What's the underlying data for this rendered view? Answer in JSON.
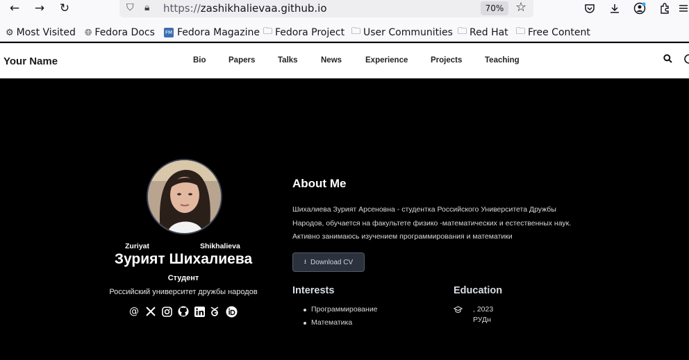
{
  "browser": {
    "url_prefix": "https://",
    "url_host": "zashikhalievaa.github.io",
    "zoom": "70%",
    "bookmarks": [
      {
        "label": "Most Visited",
        "icon": "gear-icon"
      },
      {
        "label": "Fedora Docs",
        "icon": "globe-icon"
      },
      {
        "label": "Fedora Magazine",
        "icon": "fedora-magazine-icon"
      },
      {
        "label": "Fedora Project",
        "icon": "folder-icon"
      },
      {
        "label": "User Communities",
        "icon": "folder-icon"
      },
      {
        "label": "Red Hat",
        "icon": "folder-icon"
      },
      {
        "label": "Free Content",
        "icon": "folder-icon"
      }
    ]
  },
  "navbar": {
    "brand": "Your Name",
    "items": [
      "Bio",
      "Papers",
      "Talks",
      "News",
      "Experience",
      "Projects",
      "Teaching"
    ]
  },
  "profile": {
    "first_name": "Zuriyat",
    "last_name": "Shikhalieva",
    "full_name": "Зурият Шихалиева",
    "role": "Студент",
    "organization": "Российский университет дружбы народов",
    "social_icons": [
      "email-icon",
      "x-twitter-icon",
      "instagram-icon",
      "github-icon",
      "linkedin-icon",
      "google-scholar-icon",
      "orcid-icon"
    ]
  },
  "about": {
    "title": "About Me",
    "bio_lines": [
      "Шихалиева Зурият Арсеновна - студентка Российского Университета Дружбы",
      "Народов, обучается на факультете физико -математических и естественных наук.",
      "Активно занимаюсь изучением программирования и математики"
    ],
    "cv_button": "Download CV",
    "interests_title": "Interests",
    "interests": [
      "Программирование",
      "Математика"
    ],
    "education_title": "Education",
    "education_year": ", 2023",
    "education_institution": "РУДн"
  },
  "colors": {
    "page_bg": "#000000",
    "navbar_bg": "#ffffff",
    "button_bg": "#2b323d"
  }
}
